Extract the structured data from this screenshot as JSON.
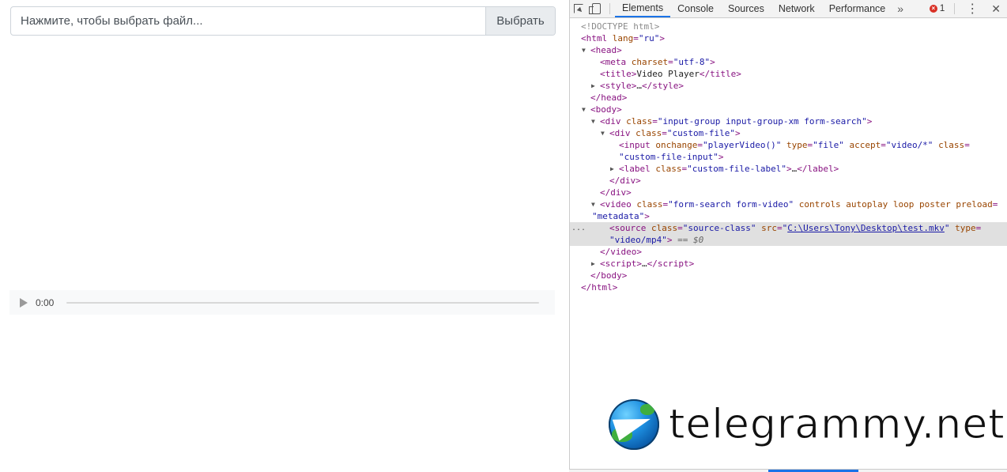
{
  "page": {
    "file_input": {
      "label": "Нажмите, чтобы выбрать файл...",
      "button": "Выбрать"
    },
    "audio_player": {
      "time": "0:00"
    }
  },
  "devtools": {
    "tabs": [
      "Elements",
      "Console",
      "Sources",
      "Network",
      "Performance"
    ],
    "active_tab": "Elements",
    "more_label": "»",
    "error_count": "1",
    "error_badge_glyph": "×",
    "menu_glyph": "⋮",
    "close_glyph": "✕",
    "selected_marker": "...",
    "accent_color": "#1a73e8",
    "tree": {
      "doctype": "<!DOCTYPE html>",
      "html_open": {
        "tag": "html",
        "attr": "lang",
        "value": "\"ru\""
      },
      "head": "head",
      "meta": {
        "tag": "meta",
        "attr": "charset",
        "value": "\"utf-8\""
      },
      "title": {
        "tag": "title",
        "text": "Video Player"
      },
      "style": {
        "tag": "style",
        "text": "…"
      },
      "body": "body",
      "div1": {
        "tag": "div",
        "attr": "class",
        "value": "\"input-group input-group-xm form-search\""
      },
      "div2": {
        "tag": "div",
        "attr": "class",
        "value": "\"custom-file\""
      },
      "input": {
        "tag": "input",
        "attr1": "onchange",
        "val1": "\"playerVideo()\"",
        "attr2": "type",
        "val2": "\"file\"",
        "attr3": "accept",
        "val3": "\"video/*\"",
        "attr4": "class",
        "val4": "\"custom-file-input\""
      },
      "label": {
        "tag": "label",
        "attr": "class",
        "value": "\"custom-file-label\"",
        "text": "…"
      },
      "video": {
        "tag": "video",
        "attr": "class",
        "value": "\"form-search form-video\"",
        "flags": "controls autoplay loop poster",
        "attr2": "preload",
        "val2": "\"metadata\""
      },
      "source": {
        "tag": "source",
        "attr1": "class",
        "val1": "\"source-class\"",
        "attr2": "src",
        "src": "C:\\Users\\Tony\\Desktop\\test.mkv",
        "attr3": "type",
        "val3": "\"video/mp4\"",
        "eq": "==",
        "dollar": "$0"
      },
      "script": {
        "tag": "script",
        "text": "…"
      }
    }
  },
  "watermark": {
    "text": "telegrammy.net"
  }
}
